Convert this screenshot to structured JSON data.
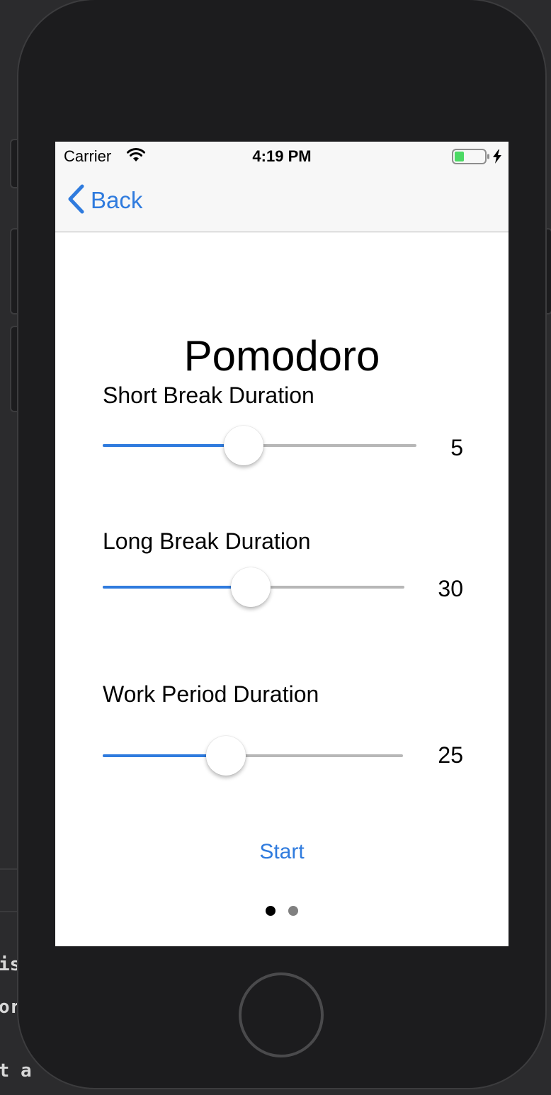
{
  "status_bar": {
    "carrier": "Carrier",
    "time": "4:19 PM"
  },
  "nav": {
    "back_label": "Back"
  },
  "title": "Pomodoro",
  "settings": [
    {
      "label": "Short Break Duration",
      "value": "5",
      "slider_fraction": 0.45
    },
    {
      "label": "Long Break Duration",
      "value": "30",
      "slider_fraction": 0.49
    },
    {
      "label": "Work Period Duration",
      "value": "25",
      "slider_fraction": 0.41
    }
  ],
  "start_label": "Start",
  "page_control": {
    "pages": 2,
    "current": 0
  },
  "colors": {
    "accent": "#2f7bde",
    "track": "#b7b7b7",
    "nav_background": "#f7f7f7"
  },
  "background_code_fragments": [
    "is",
    "or",
    "st a"
  ]
}
